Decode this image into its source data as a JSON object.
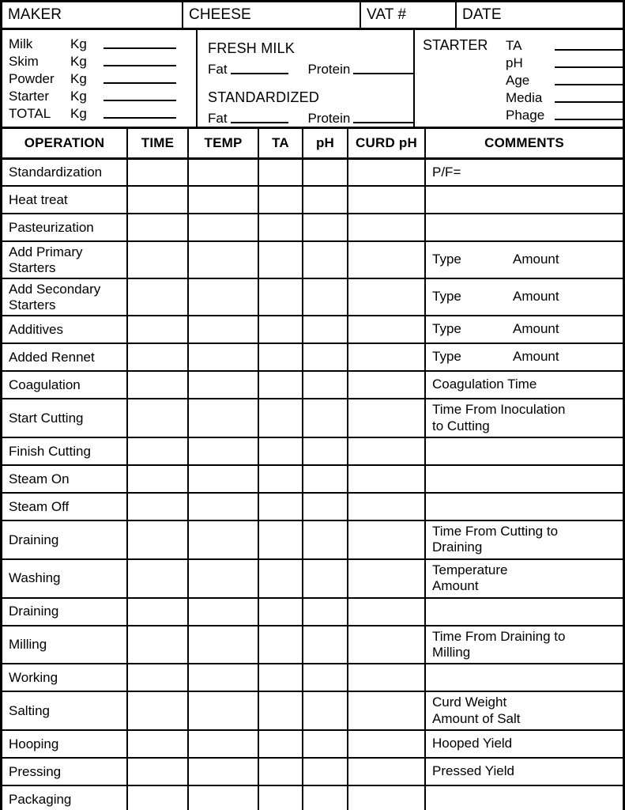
{
  "identification": {
    "fields": [
      {
        "label": "MAKER"
      },
      {
        "label": "CHEESE"
      },
      {
        "label": "VAT #"
      },
      {
        "label": "DATE"
      }
    ]
  },
  "milk_panel": {
    "rows": [
      {
        "name": "Milk",
        "unit": "Kg"
      },
      {
        "name": "Skim",
        "unit": "Kg"
      },
      {
        "name": "Powder",
        "unit": "Kg"
      },
      {
        "name": "Starter",
        "unit": "Kg"
      },
      {
        "name": "TOTAL",
        "unit": "Kg"
      }
    ]
  },
  "composition_panel": {
    "sections": [
      {
        "title": "FRESH MILK",
        "fat_label": "Fat",
        "protein_label": "Protein"
      },
      {
        "title": "STANDARDIZED",
        "fat_label": "Fat",
        "protein_label": "Protein"
      }
    ]
  },
  "starter_panel": {
    "heading": "STARTER",
    "rows": [
      {
        "name": "TA"
      },
      {
        "name": "pH"
      },
      {
        "name": "Age"
      },
      {
        "name": "Media"
      },
      {
        "name": "Phage"
      }
    ]
  },
  "operations_table": {
    "columns": [
      "OPERATION",
      "TIME",
      "TEMP",
      "TA",
      "pH",
      "CURD pH",
      "COMMENTS"
    ],
    "rows": [
      {
        "operation": "Standardization",
        "comment": "P/F=",
        "tall": false
      },
      {
        "operation": "Heat treat",
        "comment": "",
        "tall": false
      },
      {
        "operation": "Pasteurization",
        "comment": "",
        "tall": false
      },
      {
        "operation": "Add Primary Starters",
        "type": "Type",
        "amount": "Amount",
        "tall": true
      },
      {
        "operation": "Add Secondary Starters",
        "type": "Type",
        "amount": "Amount",
        "tall": true
      },
      {
        "operation": "Additives",
        "type": "Type",
        "amount": "Amount",
        "tall": false
      },
      {
        "operation": "Added Rennet",
        "type": "Type",
        "amount": "Amount",
        "tall": false
      },
      {
        "operation": "Coagulation",
        "comment": "Coagulation Time",
        "tall": false
      },
      {
        "operation": "Start Cutting",
        "comment": "Time From Inoculation to Cutting",
        "tall": true
      },
      {
        "operation": "Finish Cutting",
        "comment": "",
        "tall": false
      },
      {
        "operation": "Steam On",
        "comment": "",
        "tall": false
      },
      {
        "operation": "Steam Off",
        "comment": "",
        "tall": false
      },
      {
        "operation": "Draining",
        "comment": "Time From Cutting to Draining",
        "tall": true
      },
      {
        "operation": "Washing",
        "comment": "Temperature Amount",
        "tall": true
      },
      {
        "operation": "Draining",
        "comment": "",
        "tall": false
      },
      {
        "operation": "Milling",
        "comment": "Time From Draining to Milling",
        "tall": true
      },
      {
        "operation": "Working",
        "comment": "",
        "tall": false
      },
      {
        "operation": "Salting",
        "comment": "Curd Weight Amount of Salt",
        "tall": true
      },
      {
        "operation": "Hooping",
        "comment": "Hooped Yield",
        "tall": false
      },
      {
        "operation": "Pressing",
        "comment": "Pressed Yield",
        "tall": false
      },
      {
        "operation": "Packaging",
        "comment": "",
        "tall": false
      }
    ],
    "multiline_comments": {
      "Start Cutting": [
        "Time From Inoculation",
        "to Cutting"
      ],
      "Draining": [
        "Time From Cutting to",
        "Draining"
      ],
      "Washing": [
        "Temperature",
        "Amount"
      ],
      "Milling": [
        "Time From Draining to",
        "Milling"
      ],
      "Salting": [
        "Curd Weight",
        "Amount of Salt"
      ]
    },
    "multiline_operations": {
      "Add Primary Starters": [
        "Add Primary",
        "Starters"
      ],
      "Add Secondary Starters": [
        "Add Secondary",
        "Starters"
      ]
    }
  },
  "colors": {
    "border": "#000000",
    "background": "#ffffff",
    "text": "#000000"
  }
}
